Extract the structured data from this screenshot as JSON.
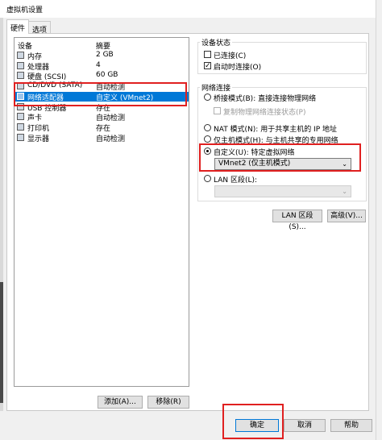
{
  "window": {
    "title": "虚拟机设置"
  },
  "tabs": [
    {
      "label": "硬件"
    },
    {
      "label": "选项"
    }
  ],
  "device_list": {
    "headers": {
      "device": "设备",
      "summary": "摘要"
    },
    "rows": [
      {
        "name": "内存",
        "summary": "2 GB",
        "icon": "memory-icon"
      },
      {
        "name": "处理器",
        "summary": "4",
        "icon": "processor-icon"
      },
      {
        "name": "硬盘 (SCSI)",
        "summary": "60 GB",
        "icon": "hard-disk-icon"
      },
      {
        "name": "CD/DVD (SATA)",
        "summary": "自动检测",
        "icon": "cd-dvd-icon"
      },
      {
        "name": "网络适配器",
        "summary": "自定义 (VMnet2)",
        "icon": "network-adapter-icon"
      },
      {
        "name": "USB 控制器",
        "summary": "存在",
        "icon": "usb-icon"
      },
      {
        "name": "声卡",
        "summary": "自动检测",
        "icon": "sound-card-icon"
      },
      {
        "name": "打印机",
        "summary": "存在",
        "icon": "printer-icon"
      },
      {
        "name": "显示器",
        "summary": "自动检测",
        "icon": "display-icon"
      }
    ],
    "selected_index": 4,
    "add_button": "添加(A)...",
    "remove_button": "移除(R)"
  },
  "device_status": {
    "title": "设备状态",
    "connected": {
      "label": "已连接(C)",
      "checked": false
    },
    "connect_on_power": {
      "label": "启动时连接(O)",
      "checked": true
    }
  },
  "network_connection": {
    "title": "网络连接",
    "options": [
      {
        "label": "桥接模式(B): 直接连接物理网络",
        "selected": false
      },
      {
        "label": "NAT 模式(N): 用于共享主机的 IP 地址",
        "selected": false
      },
      {
        "label": "仅主机模式(H): 与主机共享的专用网络",
        "selected": false
      },
      {
        "label": "自定义(U): 特定虚拟网络",
        "selected": true
      },
      {
        "label": "LAN 区段(L):",
        "selected": false
      }
    ],
    "replicate_state": {
      "label": "复制物理网络连接状态(P)",
      "checked": false
    },
    "custom_network_value": "VMnet2 (仅主机模式)",
    "lan_segment_value": ""
  },
  "buttons": {
    "lan_segments": "LAN 区段(S)...",
    "advanced": "高级(V)...",
    "ok": "确定",
    "cancel": "取消",
    "help": "帮助"
  },
  "icons": {
    "checkmark": "✓",
    "chevron": "⌄"
  },
  "colors": {
    "selection": "#0078d7",
    "highlight_box": "#e02020"
  }
}
